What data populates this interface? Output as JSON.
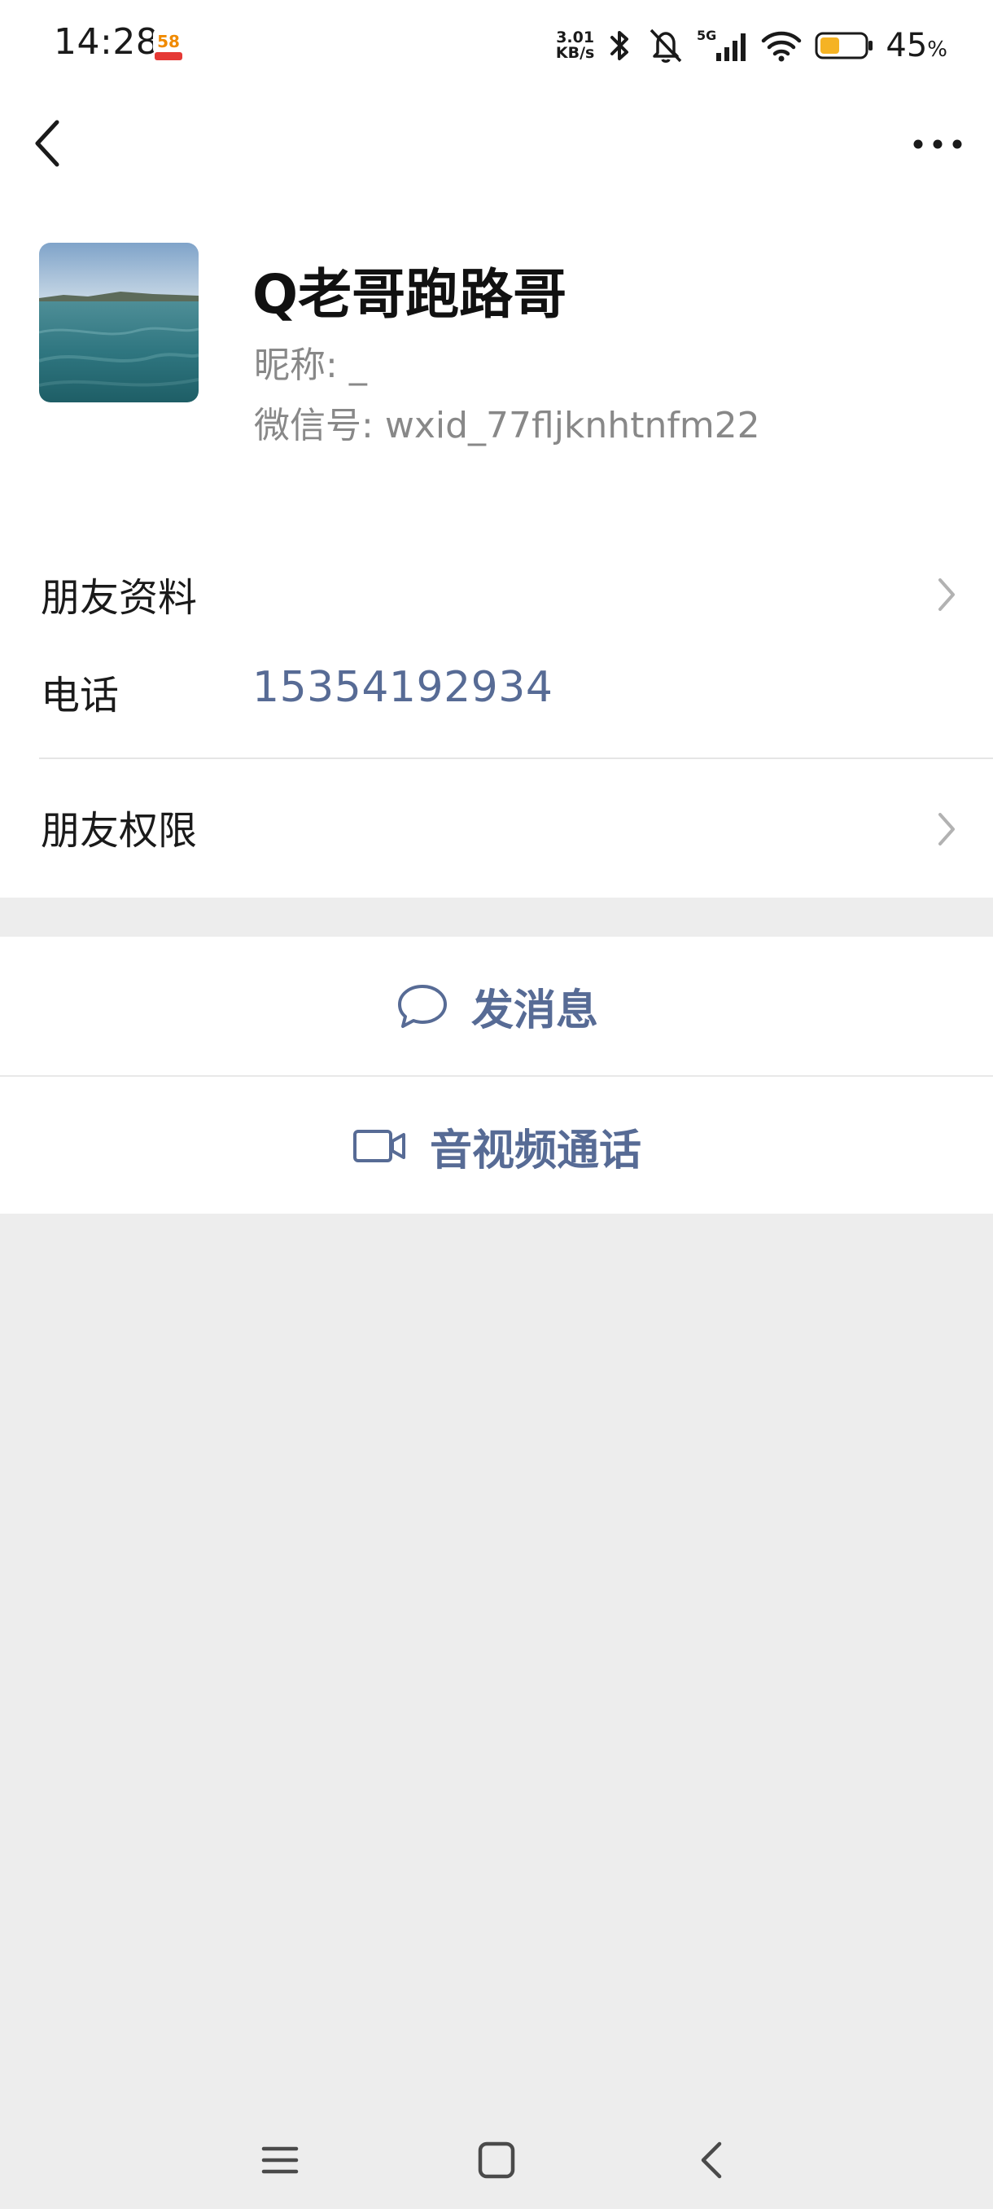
{
  "status_bar": {
    "time": "14:28",
    "app_badge_text": "58",
    "net_speed_value": "3.01",
    "net_speed_unit": "KB/s",
    "network_type": "5G",
    "battery_percent": "45",
    "battery_unit": "%",
    "battery_level": 0.45,
    "battery_color": "#F5B324",
    "icons": [
      "app-58-badge",
      "bluetooth-icon",
      "muted-bell-icon",
      "signal-5g-icon",
      "wifi-icon",
      "battery-icon"
    ]
  },
  "header": {
    "back_icon": "back-chevron-icon",
    "more_icon": "more-dots-icon"
  },
  "profile": {
    "name": "Q老哥跑路哥",
    "nickname_label": "昵称:",
    "nickname_value": "_",
    "wxid_label": "微信号:",
    "wxid_value": "wxid_77fljknhtnfm22"
  },
  "info": {
    "friend_profile_label": "朋友资料",
    "phone_label": "电话",
    "phone_value": "15354192934",
    "friend_permission_label": "朋友权限"
  },
  "actions": {
    "send_message_label": "发消息",
    "av_call_label": "音视频通话"
  },
  "colors": {
    "link_blue": "#576B95",
    "background": "#EDEDED",
    "card": "#FFFFFF"
  }
}
